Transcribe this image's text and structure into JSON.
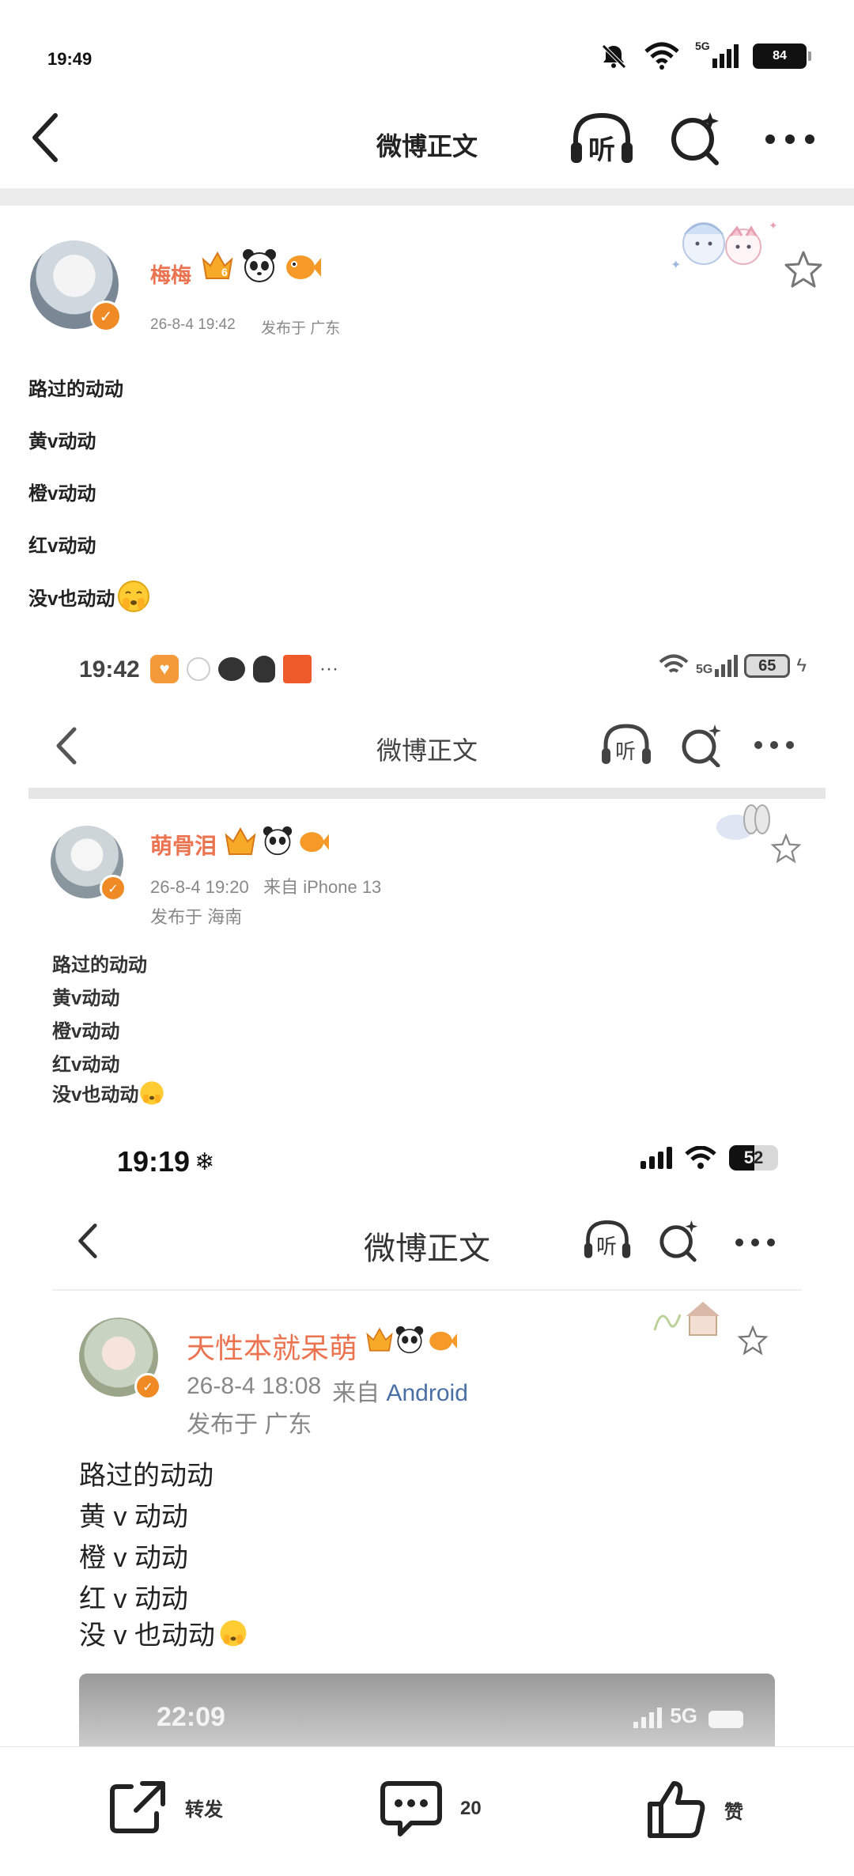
{
  "status_bar": {
    "time": "19:49",
    "network": "5G",
    "battery": "84"
  },
  "nav": {
    "title": "微博正文",
    "listen_label": "听"
  },
  "post": {
    "username": "梅梅",
    "crown_level": "6",
    "date": "26-8-4 19:42",
    "location": "发布于 广东",
    "lines": [
      "路过的动动",
      "黄v动动",
      "橙v动动",
      "红v动动",
      "没v也动动"
    ]
  },
  "screenshot2": {
    "status_time": "19:42",
    "battery": "65",
    "network": "5G",
    "nav_title": "微博正文",
    "listen_label": "听",
    "username": "萌骨泪",
    "date_source": "26-8-4 19:20   来自 iPhone 13",
    "location": "发布于 海南",
    "lines": [
      "路过的动动",
      "黄v动动",
      "橙v动动",
      "红v动动",
      "没v也动动"
    ]
  },
  "screenshot3": {
    "status_time": "19:19",
    "battery": "52",
    "nav_title": "微博正文",
    "listen_label": "听",
    "username": "天性本就呆萌",
    "date": "26-8-4 18:08",
    "source_prefix": "来自",
    "source_device": "Android",
    "location": "发布于 广东",
    "lines": [
      "路过的动动",
      "黄 v 动动",
      "橙 v 动动",
      "红 v 动动",
      "没 v 也动动"
    ],
    "inner_time": "22:09",
    "inner_network": "5G"
  },
  "bottom_bar": {
    "repost_label": "转发",
    "comment_count": "20",
    "like_label": "赞"
  },
  "colors": {
    "accent_orange": "#eb7350",
    "vip_badge": "#f08a24",
    "separator": "#ececec"
  }
}
